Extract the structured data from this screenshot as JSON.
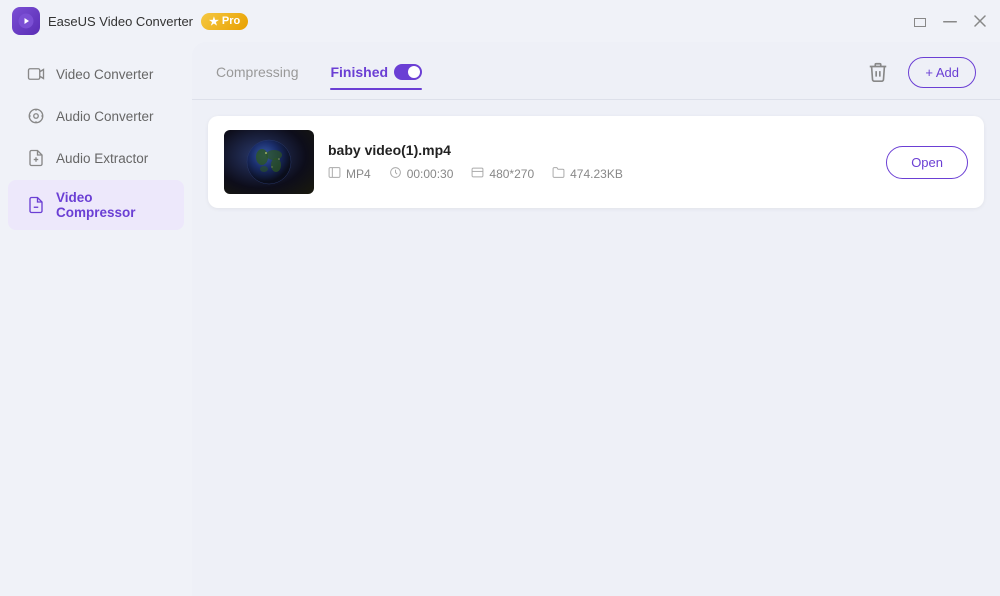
{
  "app": {
    "name": "EaseUS Video Converter",
    "logo_symbol": "▶",
    "pro_badge": "★ Pro"
  },
  "titlebar": {
    "minimize_label": "—",
    "maximize_label": "□",
    "close_label": "✕"
  },
  "sidebar": {
    "items": [
      {
        "id": "video-converter",
        "label": "Video Converter",
        "icon": "video"
      },
      {
        "id": "audio-converter",
        "label": "Audio Converter",
        "icon": "audio"
      },
      {
        "id": "audio-extractor",
        "label": "Audio Extractor",
        "icon": "extract"
      },
      {
        "id": "video-compressor",
        "label": "Video Compressor",
        "icon": "compress"
      }
    ]
  },
  "tabs": {
    "compressing": {
      "label": "Compressing"
    },
    "finished": {
      "label": "Finished"
    }
  },
  "actions": {
    "trash_label": "🗑",
    "add_label": "+ Add"
  },
  "files": [
    {
      "name": "baby video(1).mp4",
      "format": "MP4",
      "duration": "00:00:30",
      "resolution": "480*270",
      "size": "474.23KB",
      "open_button": "Open"
    }
  ]
}
